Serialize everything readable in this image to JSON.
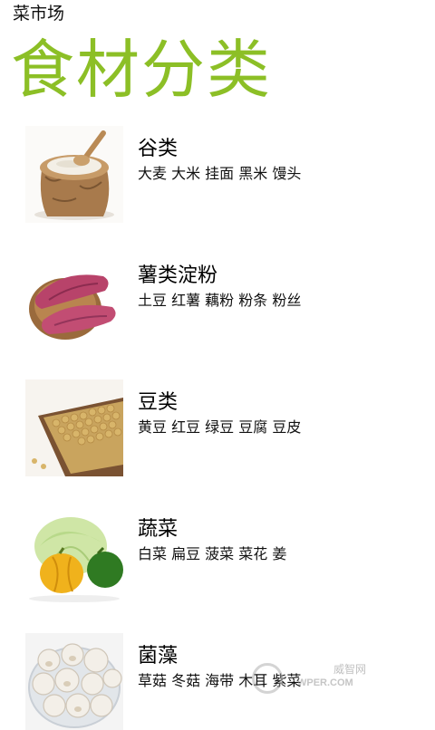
{
  "app": {
    "name": "菜市场",
    "accent_color": "#8cbf26"
  },
  "page": {
    "title": "食材分类"
  },
  "categories": [
    {
      "title": "谷类",
      "items": "大麦 大米 挂面 黑米 馒头",
      "icon": "grain-sack-image"
    },
    {
      "title": "薯类淀粉",
      "items": "土豆 红薯 藕粉 粉条 粉丝",
      "icon": "sweet-potato-image"
    },
    {
      "title": "豆类",
      "items": "黄豆 红豆 绿豆 豆腐 豆皮",
      "icon": "soybeans-image"
    },
    {
      "title": "蔬菜",
      "items": "白菜 扁豆 菠菜 菜花 姜",
      "icon": "vegetables-image"
    },
    {
      "title": "菌藻",
      "items": "草菇 冬菇 海带 木耳 紫菜",
      "icon": "mushrooms-image"
    }
  ],
  "watermark": {
    "cn": "威智网",
    "en": "WPER.COM"
  }
}
